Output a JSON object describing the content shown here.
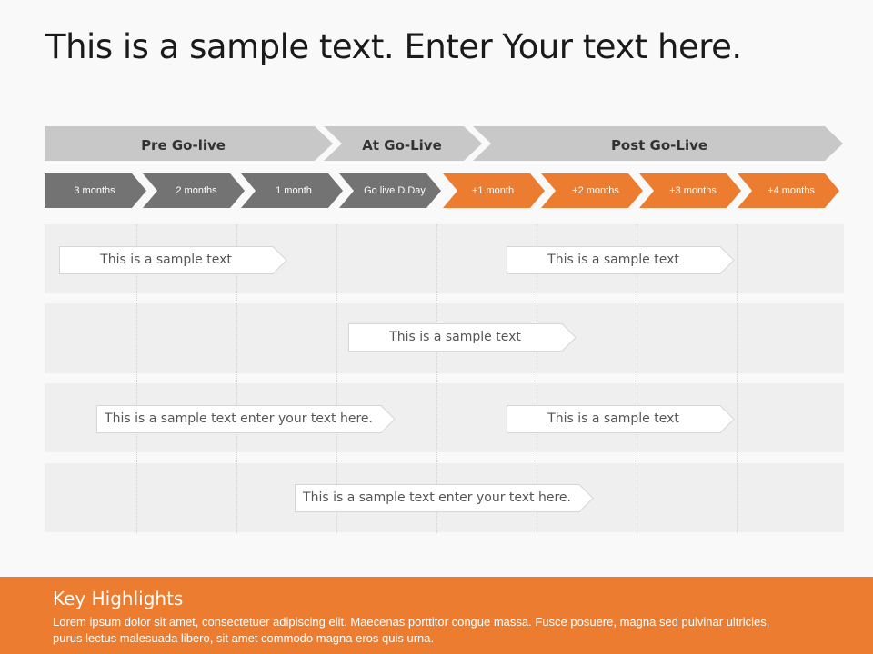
{
  "title": "This is a sample text. Enter Your text here.",
  "phases": [
    {
      "label": "Pre Go-live"
    },
    {
      "label": "At Go-Live"
    },
    {
      "label": "Post Go-Live"
    }
  ],
  "steps": [
    {
      "label": "3 months",
      "color": "#737373"
    },
    {
      "label": "2 months",
      "color": "#737373"
    },
    {
      "label": "1 month",
      "color": "#737373"
    },
    {
      "label": "Go live D Day",
      "color": "#737373"
    },
    {
      "label": "+1 month",
      "color": "#ec7c30"
    },
    {
      "label": "+2 months",
      "color": "#ec7c30"
    },
    {
      "label": "+3 months",
      "color": "#ec7c30"
    },
    {
      "label": "+4 months",
      "color": "#ec7c30"
    }
  ],
  "callouts": [
    {
      "text": "This is a sample text"
    },
    {
      "text": "This is a sample text"
    },
    {
      "text": "This is a sample text"
    },
    {
      "text": "This is a sample text enter your text here."
    },
    {
      "text": "This is a sample text"
    },
    {
      "text": "This is a sample text enter your text here."
    }
  ],
  "footer": {
    "heading": "Key Highlights",
    "body": "Lorem ipsum dolor sit amet, consectetuer adipiscing elit. Maecenas porttitor  congue massa. Fusce posuere, magna sed pulvinar ultricies, purus  lectus malesuada libero, sit amet commodo  magna eros quis urna."
  },
  "colors": {
    "accent": "#ec7c30",
    "dark_gray": "#737373",
    "phase_gray": "#c8c8c8"
  }
}
